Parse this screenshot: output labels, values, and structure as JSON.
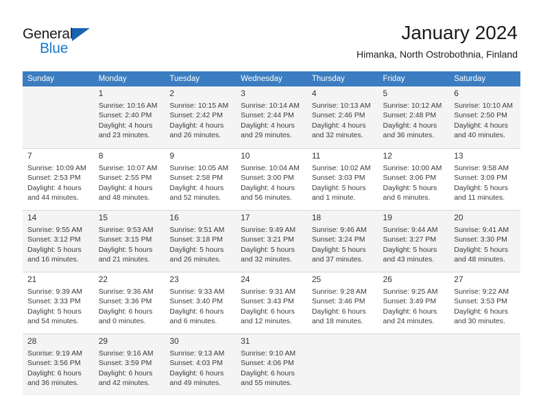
{
  "brand": {
    "name_part1": "General",
    "name_part2": "Blue",
    "accent_color": "#1878c8",
    "triangle_color": "#1565b0"
  },
  "header": {
    "title": "January 2024",
    "subtitle": "Himanka, North Ostrobothnia, Finland"
  },
  "calendar": {
    "header_bg": "#3b7dc0",
    "weekdays": [
      "Sunday",
      "Monday",
      "Tuesday",
      "Wednesday",
      "Thursday",
      "Friday",
      "Saturday"
    ],
    "weeks": [
      [
        {
          "day": "",
          "sunrise": "",
          "sunset": "",
          "daylight1": "",
          "daylight2": ""
        },
        {
          "day": "1",
          "sunrise": "Sunrise: 10:16 AM",
          "sunset": "Sunset: 2:40 PM",
          "daylight1": "Daylight: 4 hours",
          "daylight2": "and 23 minutes."
        },
        {
          "day": "2",
          "sunrise": "Sunrise: 10:15 AM",
          "sunset": "Sunset: 2:42 PM",
          "daylight1": "Daylight: 4 hours",
          "daylight2": "and 26 minutes."
        },
        {
          "day": "3",
          "sunrise": "Sunrise: 10:14 AM",
          "sunset": "Sunset: 2:44 PM",
          "daylight1": "Daylight: 4 hours",
          "daylight2": "and 29 minutes."
        },
        {
          "day": "4",
          "sunrise": "Sunrise: 10:13 AM",
          "sunset": "Sunset: 2:46 PM",
          "daylight1": "Daylight: 4 hours",
          "daylight2": "and 32 minutes."
        },
        {
          "day": "5",
          "sunrise": "Sunrise: 10:12 AM",
          "sunset": "Sunset: 2:48 PM",
          "daylight1": "Daylight: 4 hours",
          "daylight2": "and 36 minutes."
        },
        {
          "day": "6",
          "sunrise": "Sunrise: 10:10 AM",
          "sunset": "Sunset: 2:50 PM",
          "daylight1": "Daylight: 4 hours",
          "daylight2": "and 40 minutes."
        }
      ],
      [
        {
          "day": "7",
          "sunrise": "Sunrise: 10:09 AM",
          "sunset": "Sunset: 2:53 PM",
          "daylight1": "Daylight: 4 hours",
          "daylight2": "and 44 minutes."
        },
        {
          "day": "8",
          "sunrise": "Sunrise: 10:07 AM",
          "sunset": "Sunset: 2:55 PM",
          "daylight1": "Daylight: 4 hours",
          "daylight2": "and 48 minutes."
        },
        {
          "day": "9",
          "sunrise": "Sunrise: 10:05 AM",
          "sunset": "Sunset: 2:58 PM",
          "daylight1": "Daylight: 4 hours",
          "daylight2": "and 52 minutes."
        },
        {
          "day": "10",
          "sunrise": "Sunrise: 10:04 AM",
          "sunset": "Sunset: 3:00 PM",
          "daylight1": "Daylight: 4 hours",
          "daylight2": "and 56 minutes."
        },
        {
          "day": "11",
          "sunrise": "Sunrise: 10:02 AM",
          "sunset": "Sunset: 3:03 PM",
          "daylight1": "Daylight: 5 hours",
          "daylight2": "and 1 minute."
        },
        {
          "day": "12",
          "sunrise": "Sunrise: 10:00 AM",
          "sunset": "Sunset: 3:06 PM",
          "daylight1": "Daylight: 5 hours",
          "daylight2": "and 6 minutes."
        },
        {
          "day": "13",
          "sunrise": "Sunrise: 9:58 AM",
          "sunset": "Sunset: 3:09 PM",
          "daylight1": "Daylight: 5 hours",
          "daylight2": "and 11 minutes."
        }
      ],
      [
        {
          "day": "14",
          "sunrise": "Sunrise: 9:55 AM",
          "sunset": "Sunset: 3:12 PM",
          "daylight1": "Daylight: 5 hours",
          "daylight2": "and 16 minutes."
        },
        {
          "day": "15",
          "sunrise": "Sunrise: 9:53 AM",
          "sunset": "Sunset: 3:15 PM",
          "daylight1": "Daylight: 5 hours",
          "daylight2": "and 21 minutes."
        },
        {
          "day": "16",
          "sunrise": "Sunrise: 9:51 AM",
          "sunset": "Sunset: 3:18 PM",
          "daylight1": "Daylight: 5 hours",
          "daylight2": "and 26 minutes."
        },
        {
          "day": "17",
          "sunrise": "Sunrise: 9:49 AM",
          "sunset": "Sunset: 3:21 PM",
          "daylight1": "Daylight: 5 hours",
          "daylight2": "and 32 minutes."
        },
        {
          "day": "18",
          "sunrise": "Sunrise: 9:46 AM",
          "sunset": "Sunset: 3:24 PM",
          "daylight1": "Daylight: 5 hours",
          "daylight2": "and 37 minutes."
        },
        {
          "day": "19",
          "sunrise": "Sunrise: 9:44 AM",
          "sunset": "Sunset: 3:27 PM",
          "daylight1": "Daylight: 5 hours",
          "daylight2": "and 43 minutes."
        },
        {
          "day": "20",
          "sunrise": "Sunrise: 9:41 AM",
          "sunset": "Sunset: 3:30 PM",
          "daylight1": "Daylight: 5 hours",
          "daylight2": "and 48 minutes."
        }
      ],
      [
        {
          "day": "21",
          "sunrise": "Sunrise: 9:39 AM",
          "sunset": "Sunset: 3:33 PM",
          "daylight1": "Daylight: 5 hours",
          "daylight2": "and 54 minutes."
        },
        {
          "day": "22",
          "sunrise": "Sunrise: 9:36 AM",
          "sunset": "Sunset: 3:36 PM",
          "daylight1": "Daylight: 6 hours",
          "daylight2": "and 0 minutes."
        },
        {
          "day": "23",
          "sunrise": "Sunrise: 9:33 AM",
          "sunset": "Sunset: 3:40 PM",
          "daylight1": "Daylight: 6 hours",
          "daylight2": "and 6 minutes."
        },
        {
          "day": "24",
          "sunrise": "Sunrise: 9:31 AM",
          "sunset": "Sunset: 3:43 PM",
          "daylight1": "Daylight: 6 hours",
          "daylight2": "and 12 minutes."
        },
        {
          "day": "25",
          "sunrise": "Sunrise: 9:28 AM",
          "sunset": "Sunset: 3:46 PM",
          "daylight1": "Daylight: 6 hours",
          "daylight2": "and 18 minutes."
        },
        {
          "day": "26",
          "sunrise": "Sunrise: 9:25 AM",
          "sunset": "Sunset: 3:49 PM",
          "daylight1": "Daylight: 6 hours",
          "daylight2": "and 24 minutes."
        },
        {
          "day": "27",
          "sunrise": "Sunrise: 9:22 AM",
          "sunset": "Sunset: 3:53 PM",
          "daylight1": "Daylight: 6 hours",
          "daylight2": "and 30 minutes."
        }
      ],
      [
        {
          "day": "28",
          "sunrise": "Sunrise: 9:19 AM",
          "sunset": "Sunset: 3:56 PM",
          "daylight1": "Daylight: 6 hours",
          "daylight2": "and 36 minutes."
        },
        {
          "day": "29",
          "sunrise": "Sunrise: 9:16 AM",
          "sunset": "Sunset: 3:59 PM",
          "daylight1": "Daylight: 6 hours",
          "daylight2": "and 42 minutes."
        },
        {
          "day": "30",
          "sunrise": "Sunrise: 9:13 AM",
          "sunset": "Sunset: 4:03 PM",
          "daylight1": "Daylight: 6 hours",
          "daylight2": "and 49 minutes."
        },
        {
          "day": "31",
          "sunrise": "Sunrise: 9:10 AM",
          "sunset": "Sunset: 4:06 PM",
          "daylight1": "Daylight: 6 hours",
          "daylight2": "and 55 minutes."
        },
        {
          "day": "",
          "sunrise": "",
          "sunset": "",
          "daylight1": "",
          "daylight2": ""
        },
        {
          "day": "",
          "sunrise": "",
          "sunset": "",
          "daylight1": "",
          "daylight2": ""
        },
        {
          "day": "",
          "sunrise": "",
          "sunset": "",
          "daylight1": "",
          "daylight2": ""
        }
      ]
    ]
  }
}
